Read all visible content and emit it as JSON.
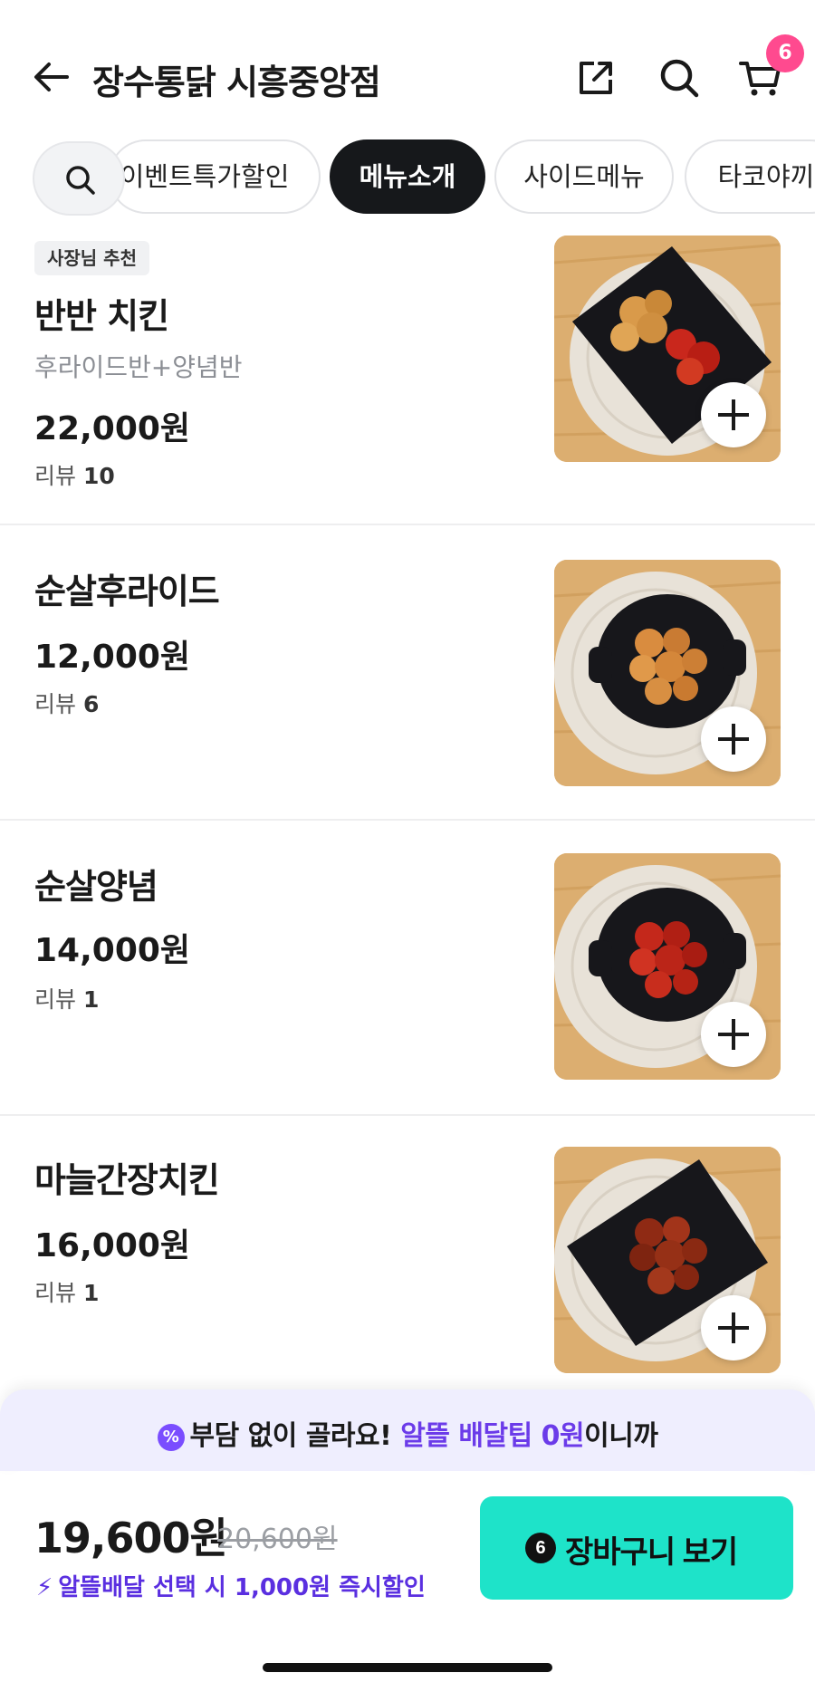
{
  "header": {
    "title": "장수통닭 시흥중앙점",
    "cart_count": "6"
  },
  "tabs": [
    {
      "label": "이벤트특가할인"
    },
    {
      "label": "메뉴소개"
    },
    {
      "label": "사이드메뉴"
    },
    {
      "label": "타코야끼"
    }
  ],
  "menu": [
    {
      "badge": "사장님 추천",
      "name": "반반 치킨",
      "desc": "후라이드반+양념반",
      "price": "22,000원",
      "review_label": "리뷰",
      "review_count": "10"
    },
    {
      "name": "순살후라이드",
      "price": "12,000원",
      "review_label": "리뷰",
      "review_count": "6"
    },
    {
      "name": "순살양념",
      "price": "14,000원",
      "review_label": "리뷰",
      "review_count": "1"
    },
    {
      "name": "마늘간장치킨",
      "price": "16,000원",
      "review_label": "리뷰",
      "review_count": "1"
    }
  ],
  "promo": {
    "text1": "부담 없이 골라요!",
    "highlight": "알뜰 배달팁 0원",
    "text2": "이니까"
  },
  "bottom": {
    "total": "19,600원",
    "original": "20,600원",
    "note": "알뜰배달 선택 시 1,000원 즉시할인",
    "cart_button_count": "6",
    "cart_button_label": "장바구니 보기"
  },
  "colors": {
    "accent_mint": "#1ee3c9",
    "accent_purple": "#6b3be9",
    "badge_pink": "#ff4a8f"
  }
}
